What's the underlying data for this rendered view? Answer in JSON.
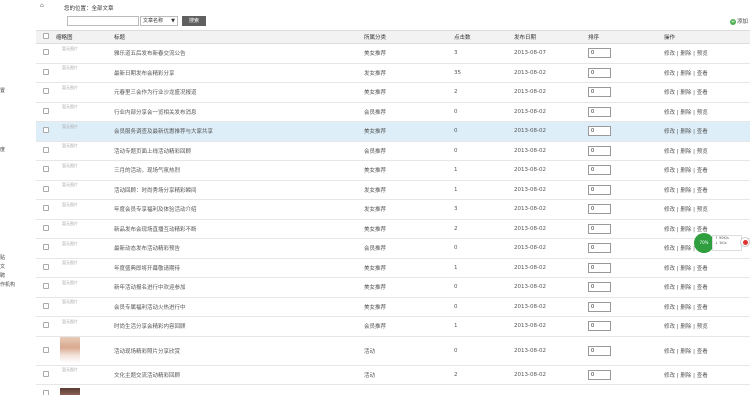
{
  "sidebar_fragments": [
    "置",
    "度",
    "贴",
    "文",
    "聘",
    "作机构"
  ],
  "topbar": {
    "location_label": "您的位置：全部文章",
    "search_placeholder": "",
    "search_select_value": "文章名称",
    "search_button": "搜索",
    "add_label": "添加"
  },
  "table": {
    "headers": [
      "",
      "缩略图",
      "标题",
      "所属分类",
      "点击数",
      "发布日期",
      "排序",
      "操作"
    ],
    "rows": [
      {
        "thumb": "暂无图片",
        "title": "雅乐道五后发布新春交流公告",
        "category": "美女推荐",
        "clicks": "3",
        "date": "2013-08-07",
        "sort": "0",
        "ops": "修改 | 删除 | 预览"
      },
      {
        "thumb": "暂无图片",
        "title": "最新日期发布会精彩分享",
        "category": "发女推荐",
        "clicks": "35",
        "date": "2013-08-02",
        "sort": "0",
        "ops": "修改 | 删除 | 查看"
      },
      {
        "thumb": "暂无图片",
        "title": "元春里三会作为行业沙龙盛况报道",
        "category": "美女推荐",
        "clicks": "2",
        "date": "2013-08-02",
        "sort": "0",
        "ops": "修改 | 删除 | 查看"
      },
      {
        "thumb": "暂无图片",
        "title": "行业内部分享会一览相关发布消息",
        "category": "会员推荐",
        "clicks": "0",
        "date": "2013-08-02",
        "sort": "0",
        "ops": "修改 | 删除 | 预览"
      },
      {
        "thumb": "暂无图片",
        "title": "会员服务调查及最新优惠推荐与大家共享",
        "category": "美女推荐",
        "clicks": "0",
        "date": "2013-08-02",
        "sort": "0",
        "ops": "修改 | 删除 | 查看"
      },
      {
        "thumb": "暂无图片",
        "title": "活动专题页面上线活动精彩回顾",
        "category": "会员推荐",
        "clicks": "0",
        "date": "2013-08-02",
        "sort": "0",
        "ops": "修改 | 删除 | 预览"
      },
      {
        "thumb": "暂无图片",
        "title": "三月的活动，现场气氛热烈",
        "category": "美女推荐",
        "clicks": "1",
        "date": "2013-08-02",
        "sort": "0",
        "ops": "修改 | 删除 | 查看"
      },
      {
        "thumb": "暂无图片",
        "title": "活动回顾：时尚秀场分享精彩瞬间",
        "category": "发女推荐",
        "clicks": "1",
        "date": "2013-08-02",
        "sort": "0",
        "ops": "修改 | 删除 | 查看"
      },
      {
        "thumb": "暂无图片",
        "title": "年度会员专享福利及体验活动介绍",
        "category": "发女推荐",
        "clicks": "3",
        "date": "2013-08-02",
        "sort": "0",
        "ops": "修改 | 删除 | 预览"
      },
      {
        "thumb": "暂无图片",
        "title": "新品发布会现场直播互动精彩不断",
        "category": "美女推荐",
        "clicks": "2",
        "date": "2013-08-02",
        "sort": "0",
        "ops": "修改 | 删除 | 查看"
      },
      {
        "thumb": "暂无图片",
        "title": "最新动态发布活动精彩预告",
        "category": "会员推荐",
        "clicks": "0",
        "date": "2013-08-02",
        "sort": "0",
        "ops": "修改 | 删除 | 预览"
      },
      {
        "thumb": "暂无图片",
        "title": "年度盛典即将开幕敬请期待",
        "category": "美女推荐",
        "clicks": "1",
        "date": "2013-08-02",
        "sort": "0",
        "ops": "修改 | 删除 | 查看"
      },
      {
        "thumb": "暂无图片",
        "title": "新年活动报名进行中欢迎参加",
        "category": "美女推荐",
        "clicks": "0",
        "date": "2013-08-02",
        "sort": "0",
        "ops": "修改 | 删除 | 查看"
      },
      {
        "thumb": "暂无图片",
        "title": "会员专属福利活动火热进行中",
        "category": "美女推荐",
        "clicks": "0",
        "date": "2013-08-02",
        "sort": "0",
        "ops": "修改 | 删除 | 查看"
      },
      {
        "thumb": "暂无图片",
        "title": "时尚生活分享会精彩内容回顾",
        "category": "会员推荐",
        "clicks": "1",
        "date": "2013-08-02",
        "sort": "0",
        "ops": "修改 | 删除 | 预览"
      },
      {
        "thumb": "photo",
        "title": "活动现场精彩照片分享欣赏",
        "category": "活动",
        "clicks": "0",
        "date": "2013-08-02",
        "sort": "0",
        "ops": "修改 | 删除 | 查看"
      },
      {
        "thumb": "暂无图片",
        "title": "文化主题交流活动精彩回顾",
        "category": "活动",
        "clicks": "2",
        "date": "2013-08-02",
        "sort": "0",
        "ops": "修改 | 删除 | 查看"
      },
      {
        "thumb": "photo2",
        "title": "",
        "category": "",
        "clicks": "",
        "date": "",
        "sort": "",
        "ops": ""
      }
    ]
  },
  "float_badge": {
    "circle_text": "70%",
    "panel_lines": [
      "↑ 90K/s",
      "↓ 1K/s"
    ]
  }
}
